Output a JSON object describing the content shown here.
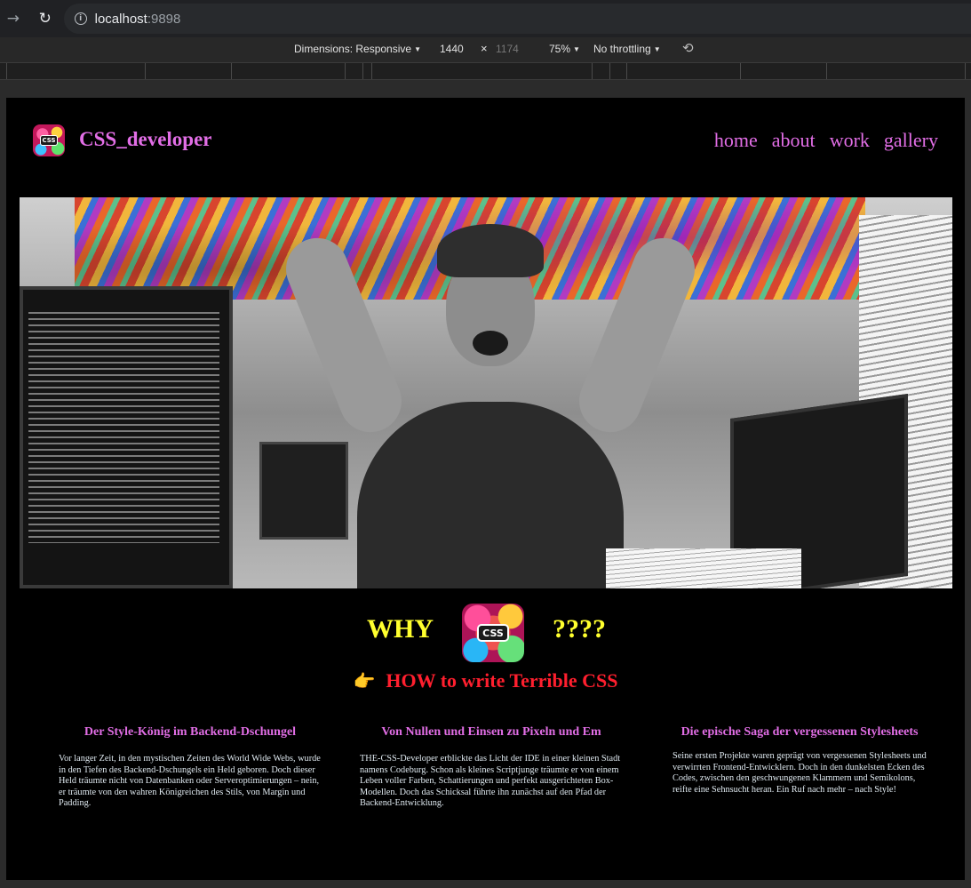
{
  "browser": {
    "url_host": "localhost",
    "url_port": ":9898",
    "back_icon": "arrow-right-icon",
    "reload_icon": "reload-icon"
  },
  "devtools": {
    "dimensions_label": "Dimensions: Responsive",
    "width": "1440",
    "times": "×",
    "height": "1174",
    "zoom": "75%",
    "throttling": "No throttling"
  },
  "site": {
    "brand": "CSS_developer",
    "nav": [
      "home",
      "about",
      "work",
      "gallery"
    ],
    "logo_text": "CSS",
    "why": {
      "left": "WHY",
      "right": "????"
    },
    "howto": {
      "icon": "👉",
      "label": "HOW to write Terrible CSS"
    },
    "columns": [
      {
        "title": "Der Style-König im Backend-Dschungel",
        "text": "Vor langer Zeit, in den mystischen Zeiten des World Wide Webs, wurde in den Tiefen des Backend-Dschungels ein Held geboren. Doch dieser Held träumte nicht von Datenbanken oder Serveroptimierungen – nein, er träumte von den wahren Königreichen des Stils, von Margin und Padding."
      },
      {
        "title": "Von Nullen und Einsen zu Pixeln und Em",
        "text": "THE-CSS-Developer erblickte das Licht der IDE in einer kleinen Stadt namens Codeburg. Schon als kleines Scriptjunge träumte er von einem Leben voller Farben, Schattierungen und perfekt ausgerichteten Box-Modellen. Doch das Schicksal führte ihn zunächst auf den Pfad der Backend-Entwicklung."
      },
      {
        "title": "Die epische Saga der vergessenen Stylesheets",
        "text": "Seine ersten Projekte waren geprägt von vergessenen Stylesheets und verwirrten Frontend-Entwicklern. Doch in den dunkelsten Ecken des Codes, zwischen den geschwungenen Klammern und Semikolons, reifte eine Sehnsucht heran. Ein Ruf nach mehr – nach Style!"
      }
    ],
    "colors": {
      "accent": "#e26ee6",
      "why": "#ffff2e",
      "howto": "#ff1f2e",
      "background": "#000000"
    }
  }
}
